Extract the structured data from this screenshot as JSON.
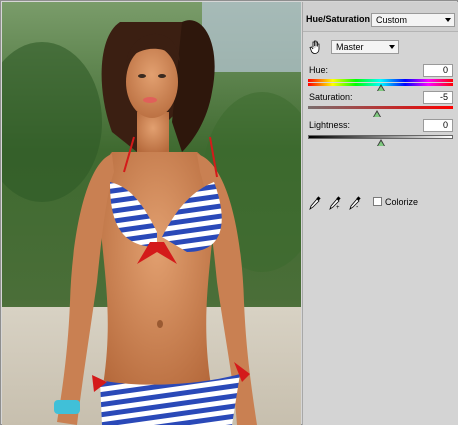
{
  "panel": {
    "title": "Hue/Saturation",
    "preset": {
      "selected": "Custom"
    },
    "channel": {
      "selected": "Master"
    },
    "hue": {
      "label": "Hue:",
      "value": "0"
    },
    "saturation": {
      "label": "Saturation:",
      "value": "-5"
    },
    "lightness": {
      "label": "Lightness:",
      "value": "0"
    },
    "colorize": {
      "label": "Colorize",
      "checked": false
    },
    "icons": [
      "target-adjust-hand-icon",
      "eyedropper-icon",
      "eyedropper-plus-icon",
      "eyedropper-minus-icon",
      "chevron-down-icon"
    ]
  },
  "colors": {
    "panel_bg": "#d4d4d4",
    "thumb_green": "#7fc87f",
    "bikini_blue": "#2a49b8",
    "bow_red": "#d41a1a"
  }
}
